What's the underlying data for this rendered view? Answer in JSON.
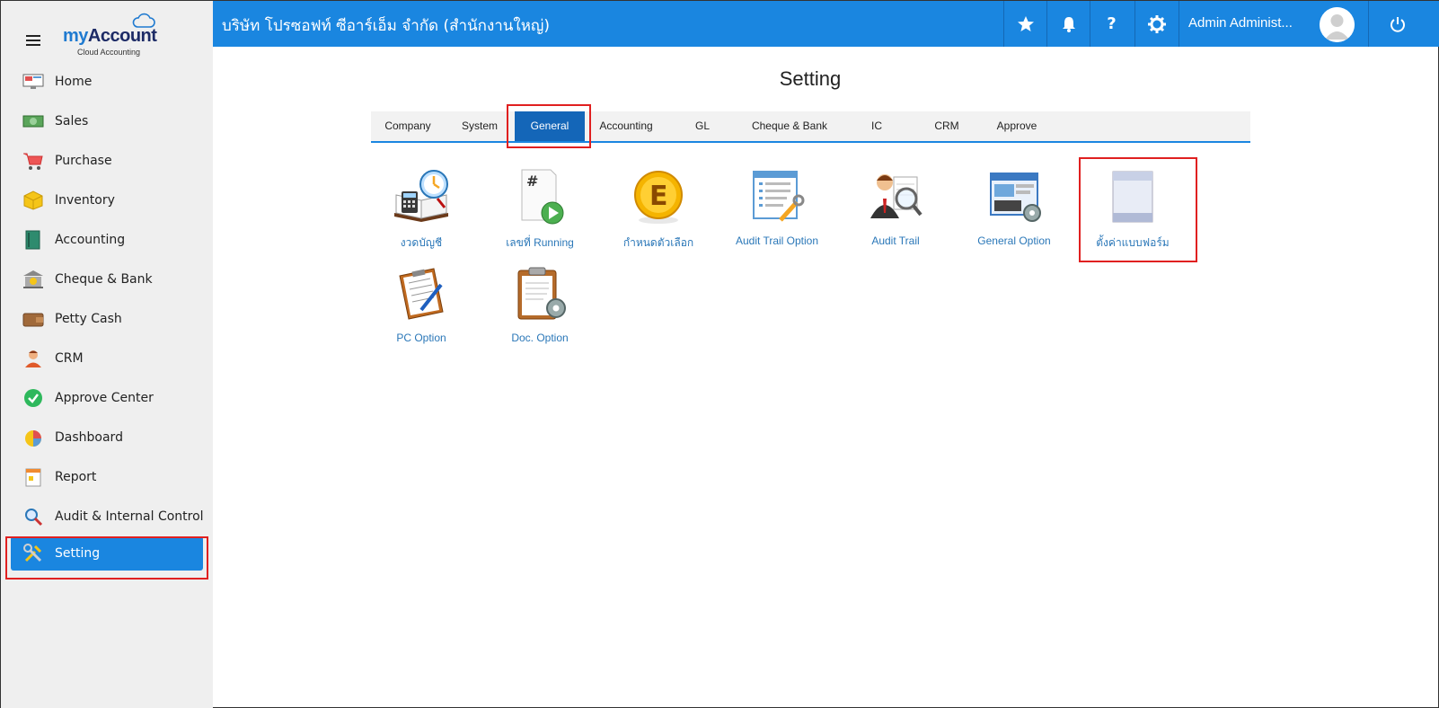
{
  "app": {
    "brand_my": "my",
    "brand_account": "Account",
    "brand_sub": "Cloud Accounting"
  },
  "header": {
    "company": "บริษัท โปรซอฟท์ ซีอาร์เอ็ม จำกัด (สำนักงานใหญ่)",
    "user": "Admin Administ...",
    "help_label": "?"
  },
  "sidebar": {
    "items": [
      {
        "label": "Home",
        "icon": "monitor-icon"
      },
      {
        "label": "Sales",
        "icon": "cash-icon"
      },
      {
        "label": "Purchase",
        "icon": "cart-icon"
      },
      {
        "label": "Inventory",
        "icon": "box-icon"
      },
      {
        "label": "Accounting",
        "icon": "book-icon"
      },
      {
        "label": "Cheque & Bank",
        "icon": "bank-icon"
      },
      {
        "label": "Petty Cash",
        "icon": "wallet-icon"
      },
      {
        "label": "CRM",
        "icon": "person-icon"
      },
      {
        "label": "Approve Center",
        "icon": "check-icon"
      },
      {
        "label": "Dashboard",
        "icon": "pie-chart-icon"
      },
      {
        "label": "Report",
        "icon": "report-icon"
      },
      {
        "label": "Audit & Internal Control",
        "icon": "magnifier-icon"
      },
      {
        "label": "Setting",
        "icon": "tools-icon"
      }
    ]
  },
  "main": {
    "title": "Setting",
    "tabs": [
      "Company",
      "System",
      "General",
      "Accounting",
      "GL",
      "Cheque & Bank",
      "IC",
      "CRM",
      "Approve"
    ],
    "active_tab": "General",
    "tiles": [
      {
        "label": "งวดบัญชี",
        "icon": "period-calendar-icon"
      },
      {
        "label": "เลขที่ Running",
        "icon": "running-number-icon"
      },
      {
        "label": "กำหนดตัวเลือก",
        "icon": "coin-e-icon"
      },
      {
        "label": "Audit Trail Option",
        "icon": "audit-trail-option-icon"
      },
      {
        "label": "Audit Trail",
        "icon": "audit-trail-icon"
      },
      {
        "label": "General Option",
        "icon": "general-option-icon"
      },
      {
        "label": "ตั้งค่าแบบฟอร์ม",
        "icon": "form-setting-icon"
      },
      {
        "label": "PC Option",
        "icon": "pc-option-icon"
      },
      {
        "label": "Doc. Option",
        "icon": "doc-option-icon"
      }
    ]
  },
  "colors": {
    "accent": "#1a86e0",
    "tab_active": "#1466b8",
    "highlight": "#e02020",
    "link": "#2a77b8"
  }
}
